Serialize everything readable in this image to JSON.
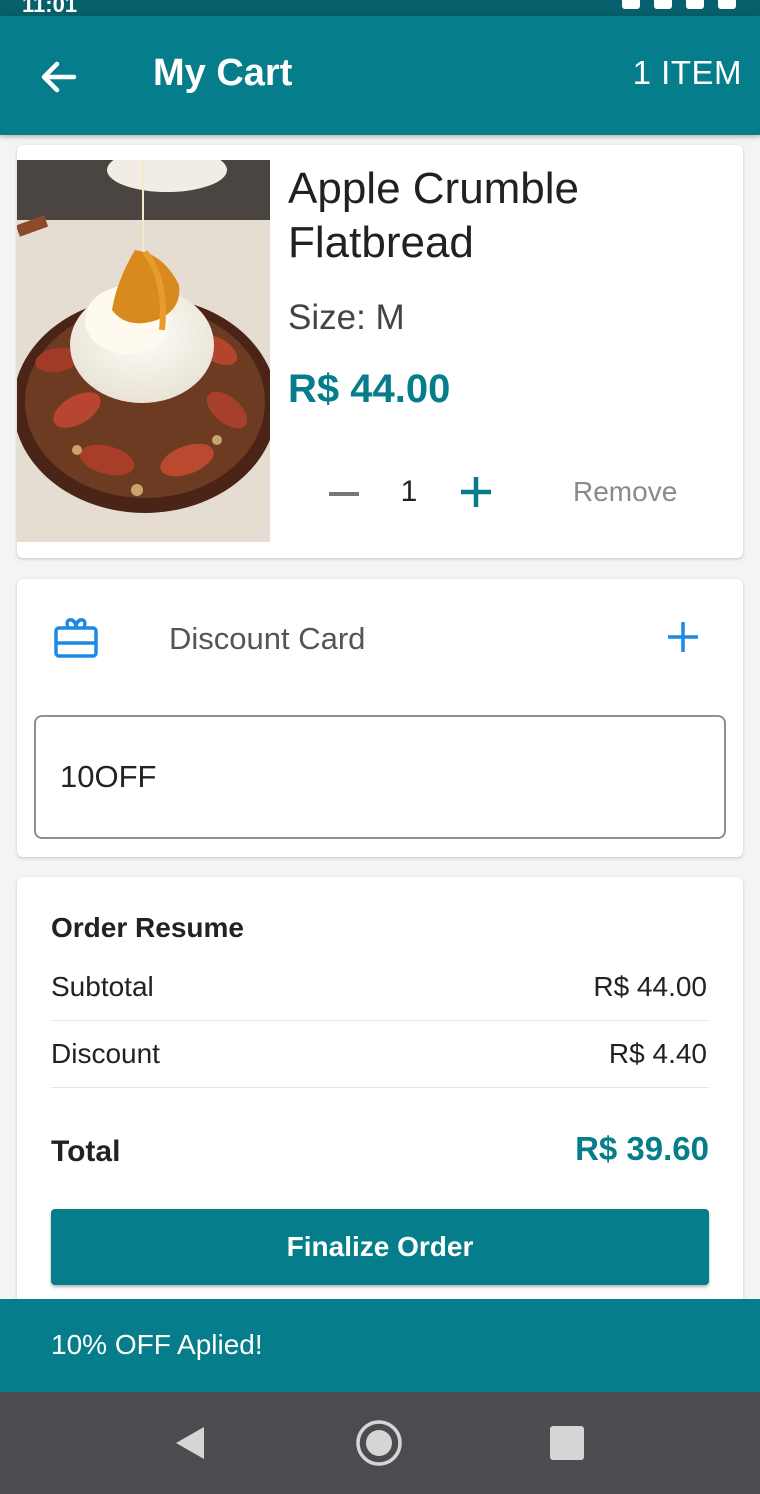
{
  "status_bar": {
    "time": "11:01"
  },
  "header": {
    "title": "My Cart",
    "item_count": "1 ITEM"
  },
  "cart_item": {
    "name": "Apple Crumble Flatbread",
    "size": "Size: M",
    "price": "R$ 44.00",
    "quantity": "1",
    "remove_label": "Remove"
  },
  "discount": {
    "label": "Discount Card",
    "code_value": "10OFF"
  },
  "summary": {
    "title": "Order Resume",
    "subtotal_label": "Subtotal",
    "subtotal_value": "R$ 44.00",
    "discount_label": "Discount",
    "discount_value": "R$ 4.40",
    "total_label": "Total",
    "total_value": "R$ 39.60",
    "finalize_label": "Finalize Order"
  },
  "snackbar": {
    "message": "10% OFF Aplied!"
  },
  "colors": {
    "primary": "#067d8a",
    "accent": "#1e88e5",
    "nav_bar": "#4a4c50"
  },
  "icons": {
    "back": "arrow-left-icon",
    "minus": "minus-icon",
    "plus": "plus-icon",
    "gift": "gift-card-icon",
    "add": "plus-icon",
    "nav_back": "triangle-back-icon",
    "nav_home": "circle-home-icon",
    "nav_recent": "square-recent-icon"
  }
}
